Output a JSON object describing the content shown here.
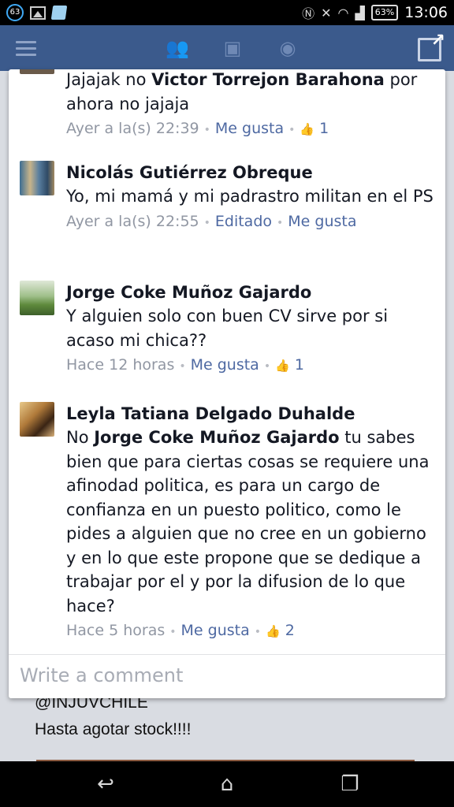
{
  "status_bar": {
    "notification_count": "63",
    "battery": "63%",
    "time": "13:06"
  },
  "header": {
    "icons": [
      "menu-icon",
      "friends-icon",
      "messages-icon",
      "globe-icon",
      "share-icon"
    ]
  },
  "comments": [
    {
      "name": "",
      "text_prefix": "Jajajak no ",
      "mention": "Victor Torrejon Barahona",
      "text_suffix": " por ahora no jajaja",
      "time": "Ayer a la(s) 22:39",
      "like_label": "Me gusta",
      "likes": "1"
    },
    {
      "name": "Nicolás Gutiérrez Obreque",
      "text": "Yo, mi mamá y mi padrastro militan en el PS",
      "time": "Ayer a la(s) 22:55",
      "edited_label": "Editado",
      "like_label": "Me gusta"
    },
    {
      "name": "Jorge Coke Muñoz Gajardo",
      "text": "Y alguien solo con buen CV sirve por si acaso mi chica??",
      "time": "Hace 12 horas",
      "like_label": "Me gusta",
      "likes": "1"
    },
    {
      "name": "Leyla Tatiana Delgado Duhalde",
      "text_prefix": "No ",
      "mention": "Jorge Coke Muñoz Gajardo",
      "text_suffix": " tu sabes bien que para ciertas cosas se requiere una afinodad politica, es para un cargo de confianza en un puesto politico, como le pides a alguien que no cree en un gobierno y en lo que este propone que se dedique a trabajar por el y por la difusion de lo que hace?",
      "time": "Hace 5 horas",
      "like_label": "Me gusta",
      "likes": "2"
    }
  ],
  "composer": {
    "placeholder": "Write a comment"
  },
  "background_post": {
    "line1": "@INJUVCHILE",
    "line2": "Hasta agotar stock!!!!"
  },
  "nav": {
    "icons": [
      "back-icon",
      "home-icon",
      "recent-apps-icon"
    ]
  },
  "colors": {
    "header_bg": "#3b5a8c",
    "link": "#4e69a2",
    "meta_gray": "#9197a3"
  }
}
